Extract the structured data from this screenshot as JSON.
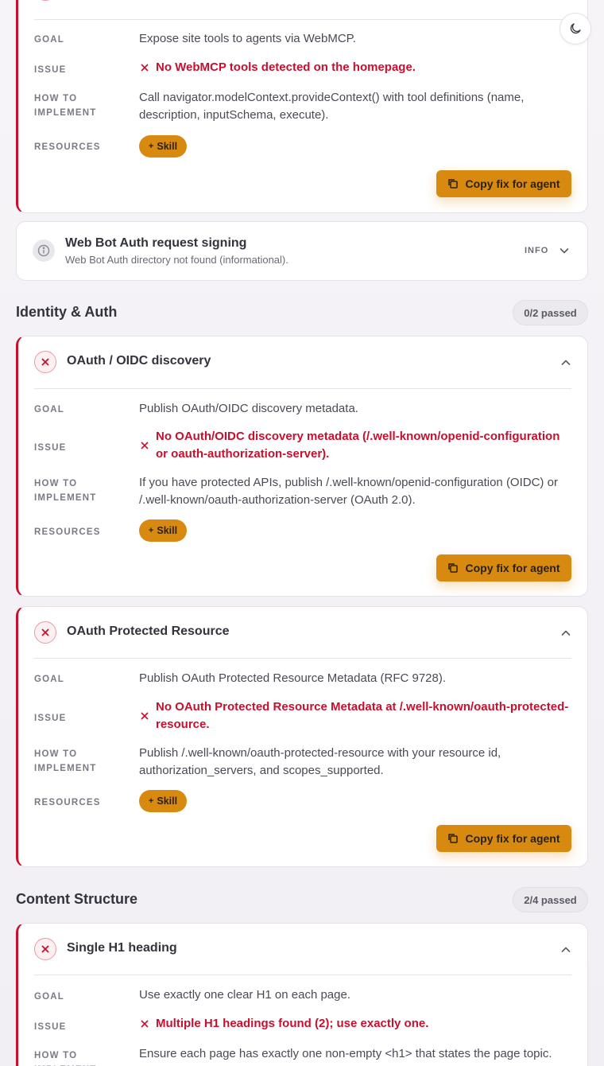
{
  "colors": {
    "fail": "#c8102e",
    "accent": "#d88a10"
  },
  "labels": {
    "goal": "GOAL",
    "issue": "ISSUE",
    "how_line1": "HOW TO",
    "how_line2": "IMPLEMENT",
    "resources": "RESOURCES",
    "skill": "Skill",
    "copy_fix": "Copy fix for agent"
  },
  "webmcp_card": {
    "goal": "Expose site tools to agents via WebMCP.",
    "issue": "No WebMCP tools detected on the homepage.",
    "how": "Call navigator.modelContext.provideContext() with tool definitions (name, description, inputSchema, execute)."
  },
  "web_bot_auth": {
    "title": "Web Bot Auth request signing",
    "subtitle": "Web Bot Auth directory not found (informational).",
    "badge": "INFO",
    "icon": "info-icon"
  },
  "identity_section": {
    "title": "Identity & Auth",
    "passed": "0/2 passed"
  },
  "oidc_card": {
    "title": "OAuth / OIDC discovery",
    "goal": "Publish OAuth/OIDC discovery metadata.",
    "issue": "No OAuth/OIDC discovery metadata (/.well-known/openid-configuration or oauth-authorization-server).",
    "how": "If you have protected APIs, publish /.well-known/openid-configuration (OIDC) or /.well-known/oauth-authorization-server (OAuth 2.0)."
  },
  "prm_card": {
    "title": "OAuth Protected Resource",
    "goal": "Publish OAuth Protected Resource Metadata (RFC 9728).",
    "issue": "No OAuth Protected Resource Metadata at /.well-known/oauth-protected-resource.",
    "how": "Publish /.well-known/oauth-protected-resource with your resource id, authorization_servers, and scopes_supported."
  },
  "content_section": {
    "title": "Content Structure",
    "passed": "2/4 passed"
  },
  "h1_card": {
    "title": "Single H1 heading",
    "goal": "Use exactly one clear H1 on each page.",
    "issue": "Multiple H1 headings found (2); use exactly one.",
    "how": "Ensure each page has exactly one non-empty <h1> that states the page topic."
  }
}
